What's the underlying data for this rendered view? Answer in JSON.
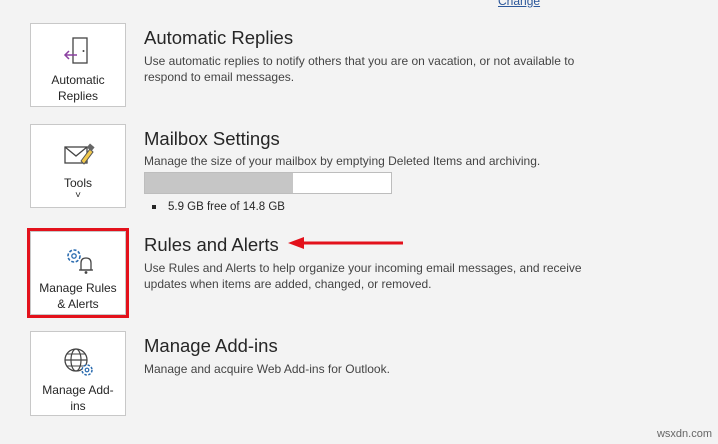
{
  "top": {
    "change_link": "Change"
  },
  "tiles": {
    "automatic_replies": {
      "line1": "Automatic",
      "line2": "Replies"
    },
    "tools": {
      "line1": "Tools",
      "chevron": "˅"
    },
    "manage_rules": {
      "line1": "Manage Rules",
      "line2": "& Alerts"
    },
    "manage_addins": {
      "line1": "Manage Add-",
      "line2": "ins"
    }
  },
  "sections": {
    "automatic_replies": {
      "title": "Automatic Replies",
      "desc": "Use automatic replies to notify others that you are on vacation, or not available to respond to email messages."
    },
    "mailbox_settings": {
      "title": "Mailbox Settings",
      "desc": "Manage the size of your mailbox by emptying Deleted Items and archiving.",
      "quota_text": "5.9 GB free of 14.8 GB",
      "used_fraction": 0.6
    },
    "rules_alerts": {
      "title": "Rules and Alerts",
      "desc": "Use Rules and Alerts to help organize your incoming email messages, and receive updates when items are added, changed, or removed."
    },
    "manage_addins": {
      "title": "Manage Add-ins",
      "desc": "Manage and acquire Web Add-ins for Outlook."
    }
  },
  "colors": {
    "highlight": "#e3111b",
    "arrow": "#e3111b",
    "link": "#2b579a"
  },
  "watermark": "wsxdn.com"
}
